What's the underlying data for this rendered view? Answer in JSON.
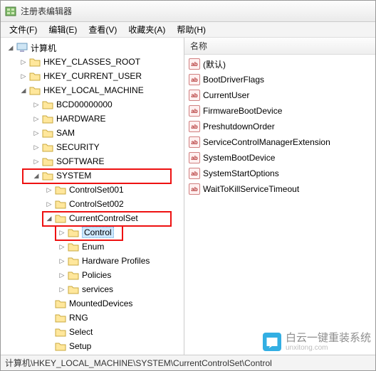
{
  "window": {
    "title": "注册表编辑器"
  },
  "menu": {
    "file": "文件(F)",
    "edit": "编辑(E)",
    "view": "查看(V)",
    "favorites": "收藏夹(A)",
    "help": "帮助(H)"
  },
  "tree": {
    "root": "计算机",
    "hkcr": "HKEY_CLASSES_ROOT",
    "hkcu": "HKEY_CURRENT_USER",
    "hklm": "HKEY_LOCAL_MACHINE",
    "bcd": "BCD00000000",
    "hardware": "HARDWARE",
    "sam": "SAM",
    "security": "SECURITY",
    "software": "SOFTWARE",
    "system": "SYSTEM",
    "cs001": "ControlSet001",
    "cs002": "ControlSet002",
    "ccs": "CurrentControlSet",
    "control": "Control",
    "enum": "Enum",
    "hwprofiles": "Hardware Profiles",
    "policies": "Policies",
    "services": "services",
    "mounted": "MountedDevices",
    "rng": "RNG",
    "select": "Select",
    "setup": "Setup"
  },
  "list": {
    "header_name": "名称",
    "items": [
      {
        "icon": "ab",
        "name": "(默认)"
      },
      {
        "icon": "ab",
        "name": "BootDriverFlags"
      },
      {
        "icon": "ab",
        "name": "CurrentUser"
      },
      {
        "icon": "ab",
        "name": "FirmwareBootDevice"
      },
      {
        "icon": "ab",
        "name": "PreshutdownOrder"
      },
      {
        "icon": "ab",
        "name": "ServiceControlManagerExtension"
      },
      {
        "icon": "ab",
        "name": "SystemBootDevice"
      },
      {
        "icon": "ab",
        "name": "SystemStartOptions"
      },
      {
        "icon": "ab",
        "name": "WaitToKillServiceTimeout"
      }
    ]
  },
  "statusbar": {
    "path": "计算机\\HKEY_LOCAL_MACHINE\\SYSTEM\\CurrentControlSet\\Control"
  },
  "watermark": {
    "main": "白云一键重装系统",
    "sub": "unxitong.com"
  }
}
